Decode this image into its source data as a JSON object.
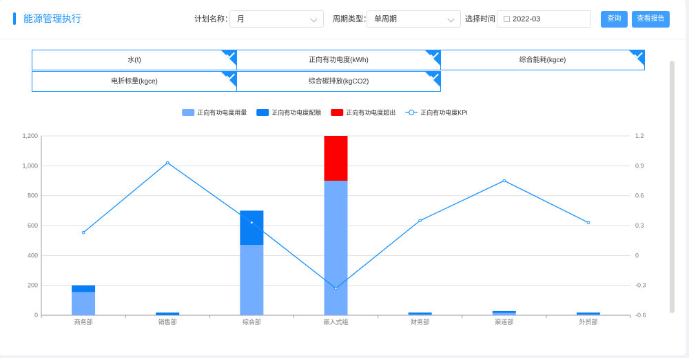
{
  "header": {
    "title": "能源管理执行",
    "plan_label": "计划名称：",
    "plan_value": "月",
    "cycle_label": "周期类型：",
    "cycle_value": "单周期",
    "time_label": "选择时间：",
    "time_value": "2022-03",
    "query_button": "查询",
    "report_button": "查看报告"
  },
  "tabs": [
    {
      "label": "水(t)",
      "selected": true
    },
    {
      "label": "正向有功电度(kWh)",
      "selected": true
    },
    {
      "label": "综合能耗(kgce)",
      "selected": true
    },
    {
      "label": "电折标量(kgce)",
      "selected": true
    },
    {
      "label": "综合碳排放(kgCO2)",
      "selected": true
    }
  ],
  "colors": {
    "accent": "#1890ff",
    "usage": "#73adff",
    "quota": "#0a7ff5",
    "excess": "#ff0000",
    "kpi": "#1890ff"
  },
  "chart_data": {
    "type": "bar",
    "categories": [
      "商务部",
      "销售部",
      "综合部",
      "嵌入式组",
      "财务部",
      "渠道部",
      "外贸部"
    ],
    "series": [
      {
        "name": "正向有功电度用量",
        "type": "bar",
        "stack": "total",
        "axis": "left",
        "values": [
          155,
          0,
          470,
          900,
          5,
          15,
          5
        ]
      },
      {
        "name": "正向有功电度配额",
        "type": "bar",
        "stack": "total",
        "axis": "left",
        "values": [
          45,
          18,
          230,
          0,
          13,
          13,
          13
        ]
      },
      {
        "name": "正向有功电度超出",
        "type": "bar",
        "stack": "total",
        "axis": "left",
        "values": [
          0,
          0,
          0,
          300,
          0,
          0,
          0
        ]
      },
      {
        "name": "正向有功电度KPI",
        "type": "line",
        "axis": "right",
        "values": [
          0.23,
          0.93,
          0.33,
          -0.33,
          0.35,
          0.75,
          0.33
        ]
      }
    ],
    "y_left": {
      "min": 0,
      "max": 1200,
      "ticks": [
        "0",
        "200",
        "400",
        "600",
        "800",
        "1,000",
        "1,200"
      ]
    },
    "y_right": {
      "min": -0.6,
      "max": 1.2,
      "ticks": [
        "-0.6",
        "-0.3",
        "0",
        "0.3",
        "0.6",
        "0.9",
        "1.2"
      ]
    },
    "legend_position": "top-center",
    "grid": true
  }
}
